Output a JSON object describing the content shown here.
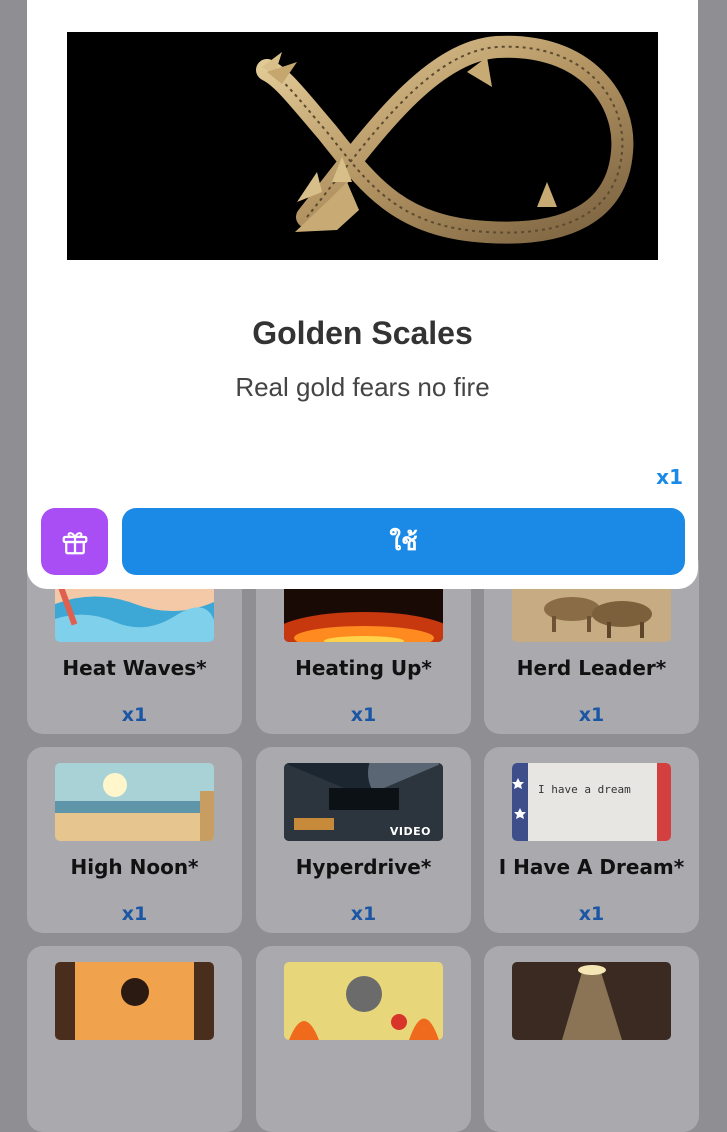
{
  "modal": {
    "title": "Golden Scales",
    "subtitle": "Real gold fears no fire",
    "quantity": "x1",
    "use_button_label": "ใช้",
    "gift_icon": "gift-icon"
  },
  "items": [
    {
      "name": "Heat Waves*",
      "qty": "x1"
    },
    {
      "name": "Heating Up*",
      "qty": "x1"
    },
    {
      "name": "Herd Leader*",
      "qty": "x1"
    },
    {
      "name": "High Noon*",
      "qty": "x1"
    },
    {
      "name": "Hyperdrive*",
      "qty": "x1",
      "badge": "VIDEO"
    },
    {
      "name": "I Have A Dream*",
      "qty": "x1",
      "thumb_text": "I have a dream"
    }
  ],
  "colors": {
    "accent_blue": "#1a8ae6",
    "gift_purple": "#a94ef5",
    "qty_blue": "#1b56a5"
  }
}
